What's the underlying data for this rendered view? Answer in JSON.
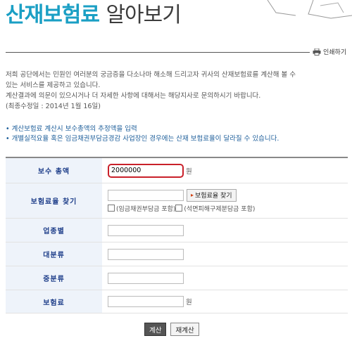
{
  "header": {
    "title_part1": "산재보험료",
    "title_part2": "알아보기",
    "print_label": "인쇄하기"
  },
  "intro": {
    "line1": "저희 공단에서는 민원인 여러분의 궁금증을 다소나마 해소해 드리고자 귀사의 산재보험료를 계산해 볼 수",
    "line2": "있는 서비스를 제공하고 있습니다.",
    "line3": "계산결과에 의문이 있으시거나 더 자세한 사항에 대해서는 해당지사로 문의하시기 바랍니다.",
    "line4": "(최종수정일 : 2014년 1월 16일)"
  },
  "notes": {
    "note1": "• 계산보험료 계산시 보수총액의 추정액을 입력",
    "note2": "• 개별실적요율 혹은 임금채권부담금경감 사업장인 경우에는 산재 보험료율이 달라질 수 있습니다."
  },
  "form": {
    "pay_total_label": "보수 총액",
    "pay_total_value": "2000000",
    "unit_won": "원",
    "rate_find_label": "보험료율 찾기",
    "rate_find_button": "보험료율 찾기",
    "check1_label": "(임금채권부담금 포함)",
    "check2_label": "(석면피해구제분담금 포함)",
    "industry_label": "업종별",
    "major_label": "대분류",
    "middle_label": "중분류",
    "premium_label": "보험료",
    "premium_unit": "원"
  },
  "buttons": {
    "calc": "계산",
    "recalc": "재계산"
  },
  "colors": {
    "title_accent": "#1a9fc4",
    "label_text": "#1f3f8a",
    "label_bg": "#eef3fa",
    "highlight": "#c9202a",
    "notes_text": "#1d5e9a"
  }
}
